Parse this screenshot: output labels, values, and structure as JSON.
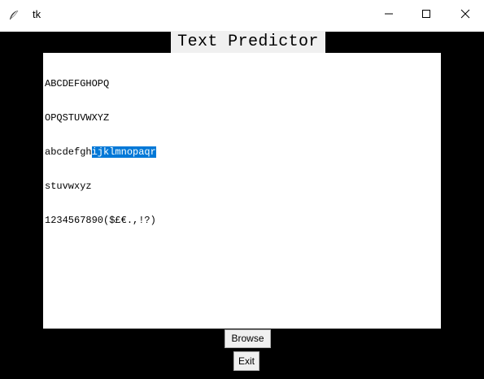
{
  "window": {
    "title": "tk",
    "icon": "feather-icon",
    "controls": {
      "minimize": "minimize-icon",
      "maximize": "maximize-icon",
      "close": "close-icon"
    }
  },
  "heading": {
    "label": "Text Predictor"
  },
  "editor": {
    "lines": [
      {
        "text": "ABCDEFGHOPQ"
      },
      {
        "text": "OPQSTUVWXYZ"
      },
      {
        "before": "abcdefgh",
        "selected": "ijklmnopaqr"
      },
      {
        "text": "stuvwxyz"
      },
      {
        "text": "1234567890($£€.,!?)"
      }
    ]
  },
  "buttons": {
    "browse_label": "Browse",
    "exit_label": "Exit"
  },
  "colors": {
    "background": "#000000",
    "selection": "#0078d7",
    "button_face": "#f0f0f0"
  }
}
